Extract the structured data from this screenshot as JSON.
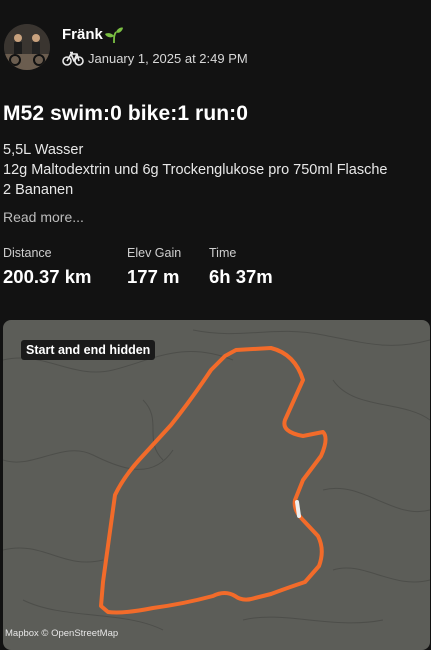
{
  "header": {
    "athlete_name": "Fränk",
    "date": "January 1, 2025 at 2:49 PM",
    "sport_icon": "bike-icon",
    "badge_icon": "sprout-icon"
  },
  "activity": {
    "title": "M52 swim:0 bike:1 run:0",
    "description": [
      "5,5L Wasser",
      "12g Maltodextrin und 6g Trockenglukose pro 750ml Flasche",
      "2 Bananen"
    ],
    "read_more": "Read more..."
  },
  "stats": [
    {
      "label": "Distance",
      "value": "200.37 km"
    },
    {
      "label": "Elev Gain",
      "value": "177 m"
    },
    {
      "label": "Time",
      "value": "6h 37m"
    }
  ],
  "map": {
    "badge": "Start and end hidden",
    "attribution": "Mapbox © OpenStreetMap",
    "route_color": "#f26b2a",
    "background_color": "#5c5d58"
  }
}
